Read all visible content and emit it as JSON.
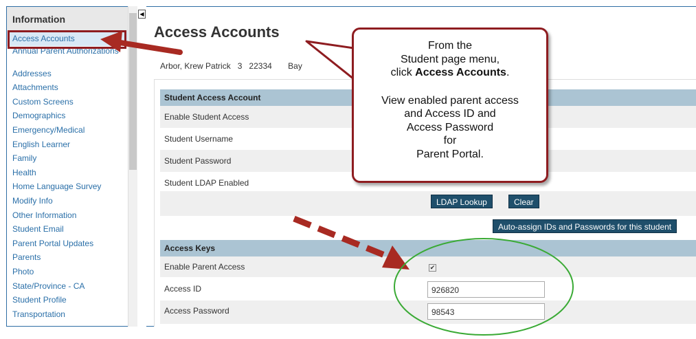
{
  "sidebar": {
    "title": "Information",
    "items": [
      {
        "label": "Access Accounts",
        "active": true
      },
      {
        "label": "Annual Parent Authorizations",
        "two_line": true
      },
      {
        "label": "Addresses"
      },
      {
        "label": "Attachments"
      },
      {
        "label": "Custom Screens"
      },
      {
        "label": "Demographics"
      },
      {
        "label": "Emergency/Medical"
      },
      {
        "label": "English Learner"
      },
      {
        "label": "Family"
      },
      {
        "label": "Health"
      },
      {
        "label": "Home Language Survey"
      },
      {
        "label": "Modify Info"
      },
      {
        "label": "Other Information"
      },
      {
        "label": "Student Email"
      },
      {
        "label": "Parent Portal Updates"
      },
      {
        "label": "Parents"
      },
      {
        "label": "Photo"
      },
      {
        "label": "State/Province - CA"
      },
      {
        "label": "Student Profile"
      },
      {
        "label": "Transportation"
      }
    ]
  },
  "collapse_glyph": "◀",
  "page": {
    "title": "Access Accounts",
    "student": {
      "name": "Arbor, Krew Patrick",
      "grade": "3",
      "id": "22334",
      "school": "Bay"
    }
  },
  "student_access": {
    "header": "Student Access Account",
    "rows": [
      "Enable Student Access",
      "Student Username",
      "Student Password",
      "Student LDAP Enabled"
    ],
    "ldap_button": "LDAP Lookup",
    "clear_button": "Clear",
    "auto_assign_button": "Auto-assign IDs and Passwords for this student"
  },
  "access_keys": {
    "header": "Access Keys",
    "enable_parent_label": "Enable Parent Access",
    "enable_parent_checked": true,
    "checkmark": "✔",
    "access_id_label": "Access ID",
    "access_id_value": "926820",
    "access_password_label": "Access Password",
    "access_password_value": "98543"
  },
  "callout": {
    "line1": "From the",
    "line2": "Student page menu,",
    "line3_prefix": "click ",
    "line3_bold": "Access Accounts",
    "line3_suffix": ".",
    "line4": "View enabled parent access",
    "line5": "and Access ID and",
    "line6": "Access Password",
    "line7": "for",
    "line8": "Parent Portal."
  },
  "colors": {
    "arrow": "#a82a22",
    "callout_border": "#8e1c20",
    "ellipse": "#3aaa35",
    "section_header": "#abc4d3",
    "button": "#1f4f6b"
  }
}
